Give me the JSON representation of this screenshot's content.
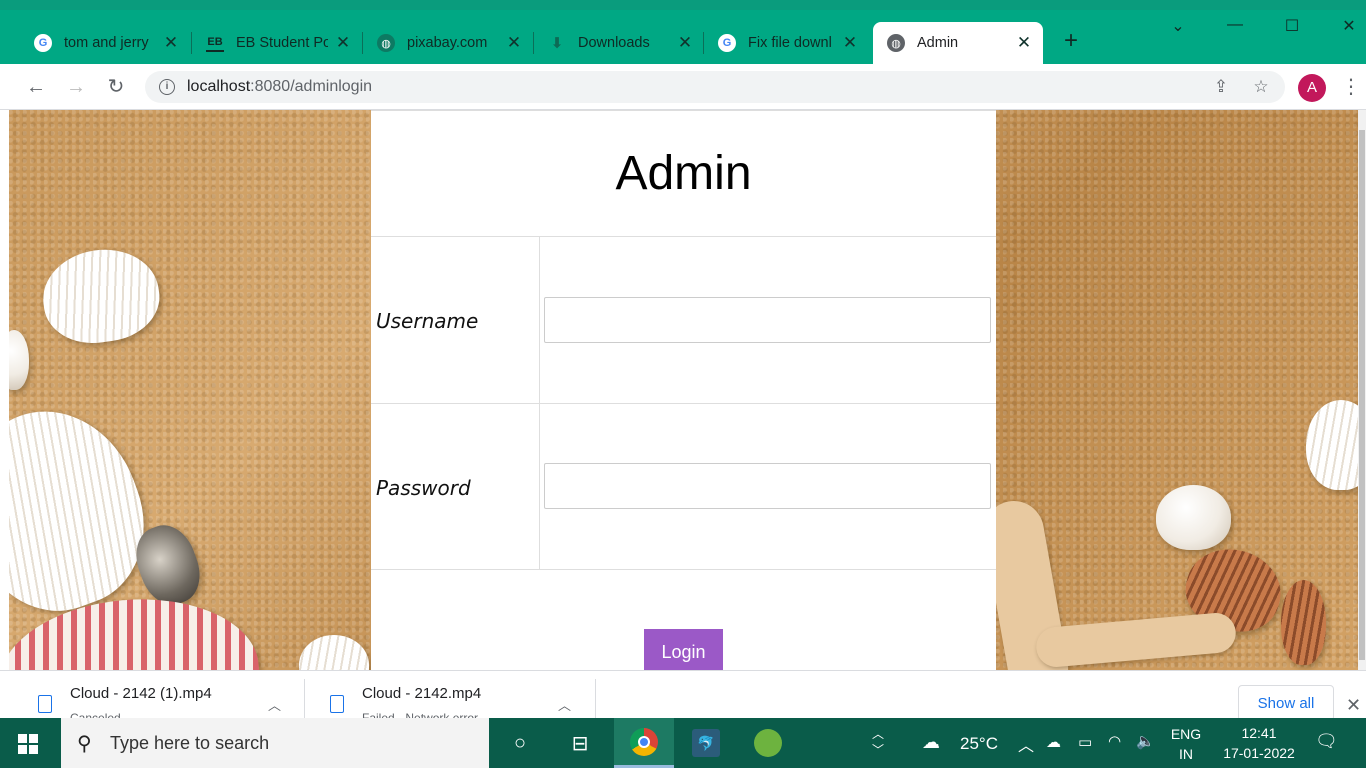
{
  "browser": {
    "tabs": [
      {
        "title": "tom and jerry",
        "icon": "google-icon"
      },
      {
        "title": "EB Student Po",
        "icon": "eb-icon"
      },
      {
        "title": "pixabay.com",
        "icon": "globe-icon"
      },
      {
        "title": "Downloads",
        "icon": "download-icon"
      },
      {
        "title": "Fix file downl",
        "icon": "google-icon"
      },
      {
        "title": "Admin",
        "icon": "globe-icon",
        "active": true
      }
    ],
    "url_host": "localhost",
    "url_rest": ":8080/adminlogin",
    "profile_initial": "A"
  },
  "form": {
    "title": "Admin",
    "username_label": "Username",
    "username_value": "",
    "password_label": "Password",
    "password_value": "",
    "login_label": "Login"
  },
  "downloads": {
    "items": [
      {
        "name": "Cloud - 2142 (1).mp4",
        "status": "Canceled"
      },
      {
        "name": "Cloud - 2142.mp4",
        "status": "Failed - Network error"
      }
    ],
    "show_all": "Show all"
  },
  "taskbar": {
    "search_placeholder": "Type here to search",
    "weather": "25°C",
    "language": "ENG",
    "region": "IN",
    "time": "12:41",
    "date": "17-01-2022"
  },
  "colors": {
    "titlebar": "#00a884",
    "button": "#9b59c7",
    "taskbar": "#0a5c4a"
  }
}
